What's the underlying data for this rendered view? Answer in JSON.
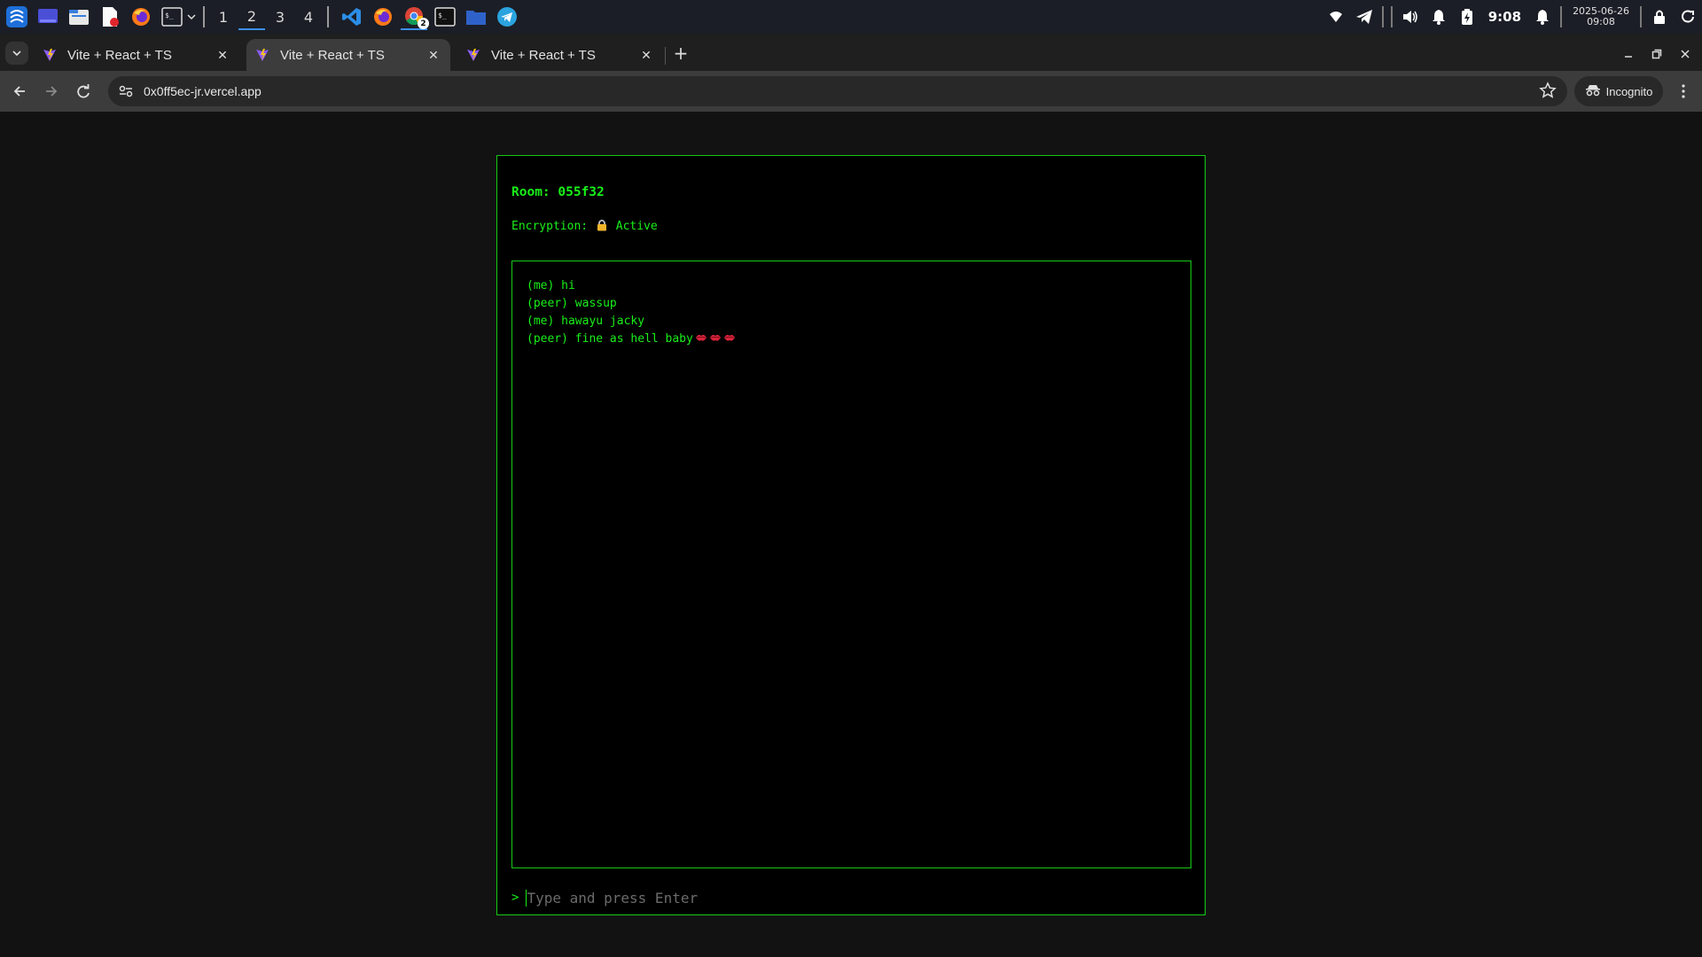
{
  "taskbar": {
    "workspaces": [
      "1",
      "2",
      "3",
      "4"
    ],
    "active_workspace": "2",
    "chrome_badge": "2",
    "clock": "9:08",
    "date": "2025-06-26",
    "date_time": "09:08"
  },
  "browser": {
    "tabs": [
      {
        "title": "Vite + React + TS",
        "active": false
      },
      {
        "title": "Vite + React + TS",
        "active": true
      },
      {
        "title": "Vite + React + TS",
        "active": false
      }
    ],
    "new_tab_label": "+",
    "url": "0x0ff5ec-jr.vercel.app",
    "incognito_label": "Incognito"
  },
  "app": {
    "room_label": "Room: 055f32",
    "encryption_label": "Encryption:",
    "encryption_status": "Active",
    "messages": [
      {
        "text": "(me) hi",
        "kisses": 0
      },
      {
        "text": "(peer) wassup",
        "kisses": 0
      },
      {
        "text": "(me) hawayu jacky",
        "kisses": 0
      },
      {
        "text": "(peer) fine as hell baby",
        "kisses": 3
      }
    ],
    "prompt_symbol": ">",
    "input_placeholder": "Type and press Enter",
    "input_value": ""
  },
  "colors": {
    "terminal_green": "#19f019",
    "accent_blue": "#3b8ef0"
  }
}
